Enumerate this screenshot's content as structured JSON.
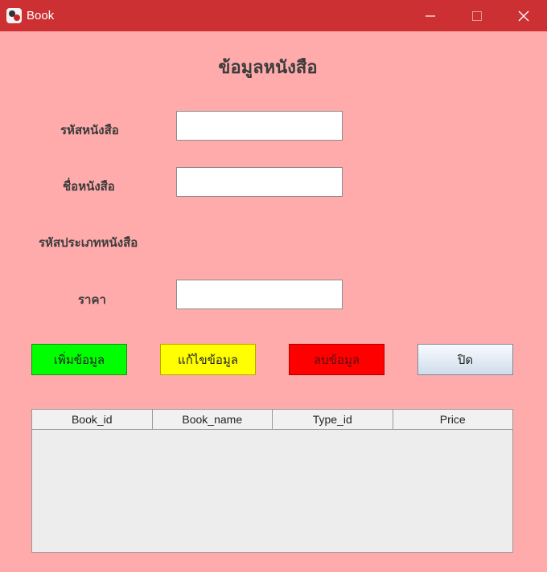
{
  "window": {
    "title": "Book"
  },
  "form": {
    "heading": "ข้อมูลหนังสือ",
    "labels": {
      "book_id": "รหัสหนังสือ",
      "book_name": "ชื่อหนังสือ",
      "type_id": "รหัสประเภทหนังสือ",
      "price": "ราคา"
    },
    "values": {
      "book_id": "",
      "book_name": "",
      "price": ""
    }
  },
  "buttons": {
    "add": "เพิ่มข้อมูล",
    "edit": "แก้ไขข้อมูล",
    "delete": "ลบข้อมูล",
    "close": "ปิด"
  },
  "table": {
    "columns": [
      "Book_id",
      "Book_name",
      "Type_id",
      "Price"
    ],
    "rows": []
  },
  "colors": {
    "titlebar": "#cc3033",
    "background": "#ffabab",
    "add_button": "#00ff00",
    "edit_button": "#ffff00",
    "delete_button": "#ff0000"
  },
  "icons": [
    "app-icon",
    "minimize-icon",
    "maximize-icon",
    "close-icon"
  ]
}
